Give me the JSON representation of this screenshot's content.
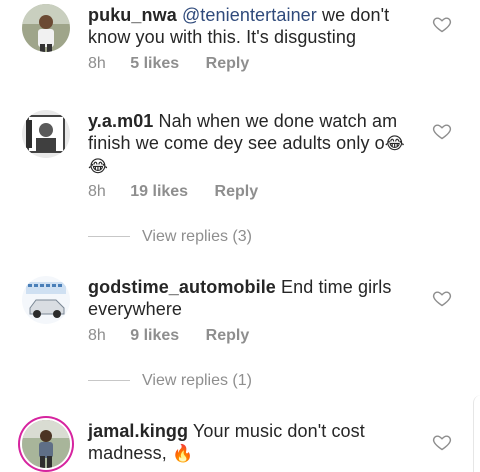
{
  "comments": [
    {
      "username": "puku_nwa",
      "mention": "@tenientertainer",
      "text": " we don't know you with this.  It's disgusting",
      "time": "8h",
      "likes": "5 likes",
      "reply": "Reply",
      "liked": false
    },
    {
      "username": "y.a.m01",
      "text": " Nah when we done watch am finish we come dey see adults only o",
      "emoji_1": "😂",
      "emoji_2": "😂",
      "time": "8h",
      "likes": "19 likes",
      "reply": "Reply",
      "view_replies": "View replies (3)"
    },
    {
      "username": "godstime_automobile",
      "text": " End time girls everywhere",
      "time": "8h",
      "likes": "9 likes",
      "reply": "Reply",
      "view_replies": "View replies (1)"
    },
    {
      "username": "jamal.kingg",
      "text": " Your music don't cost madness, ",
      "emoji_1": "🔥"
    }
  ],
  "icons": {
    "heart": "heart-outline-icon"
  },
  "colors": {
    "mention": "#2f4a7b",
    "muted": "#8e8e8e",
    "story_ring": "#d6249f"
  }
}
